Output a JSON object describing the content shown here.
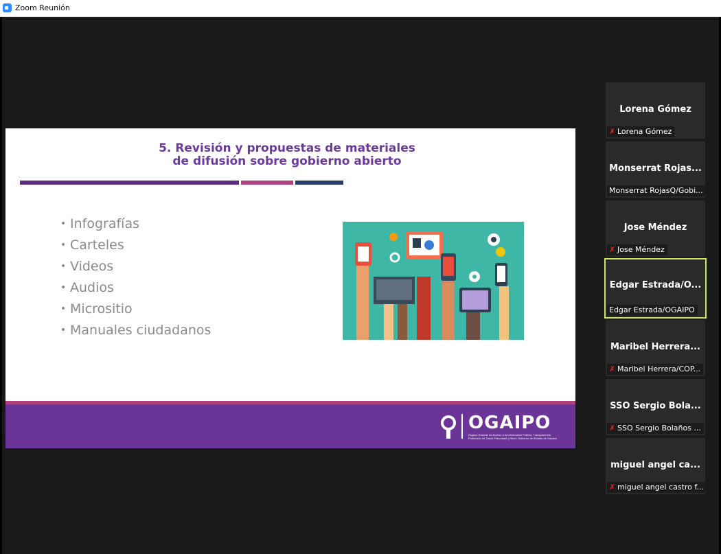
{
  "window": {
    "title": "Zoom Reunión"
  },
  "slide": {
    "title_line1": "5. Revisión y propuestas de materiales",
    "title_line2": "de difusión sobre gobierno abierto",
    "bullet_char": "•",
    "bullets": [
      "Infografías",
      "Carteles",
      "Videos",
      "Audios",
      "Micrositio",
      "Manuales ciudadanos"
    ],
    "footer_logo_text": "OGAIPO",
    "footer_logo_subtext": "Órgano Garante de Acceso a la Información Pública, Transparencia, Protección de Datos Personales y Buen Gobierno del Estado de Oaxaca"
  },
  "participants": [
    {
      "name": "Lorena Gómez",
      "label": "Lorena Gómez",
      "muted": true,
      "active": false
    },
    {
      "name": "Monserrat  Rojas...",
      "label": "Monserrat RojasQ/Gobi...",
      "muted": false,
      "active": false
    },
    {
      "name": "Jose Méndez",
      "label": "Jose Méndez",
      "muted": true,
      "active": false
    },
    {
      "name": "Edgar  Estrada/O...",
      "label": "Edgar Estrada/OGAIPO",
      "muted": false,
      "active": true
    },
    {
      "name": "Maribel  Herrera...",
      "label": "Maribel Herrera/COP...",
      "muted": true,
      "active": false
    },
    {
      "name": "SSO  Sergio  Bola...",
      "label": "SSO Sergio Bolaños ...",
      "muted": true,
      "active": false
    },
    {
      "name": "miguel  angel  ca...",
      "label": "miguel angel castro f...",
      "muted": true,
      "active": false
    }
  ],
  "colors": {
    "accent_purple": "#6a3596",
    "accent_pink": "#b0417f",
    "accent_navy": "#283c6b",
    "speaker_border": "#c8e26a",
    "muted_icon": "#e02828"
  }
}
